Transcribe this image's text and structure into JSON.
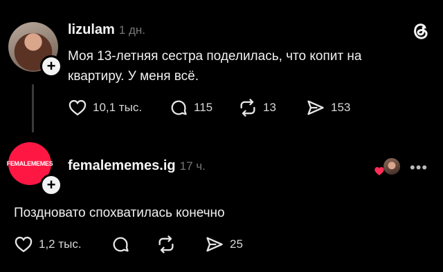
{
  "post1": {
    "username": "lizulam",
    "time": "1 дн.",
    "text_line1": "Моя 13-летняя сестра поделилась, что копит на",
    "text_line2": "квартиру. У меня всё.",
    "likes": "10,1 тыс.",
    "comments": "115",
    "reposts": "13",
    "shares": "153"
  },
  "post2": {
    "username": "femalememes.ig",
    "time": "17 ч.",
    "avatar_text": "FEMALEMEMES",
    "text": "Поздновато спохватилась конечно",
    "likes": "1,2 тыс.",
    "shares": "25"
  },
  "colors": {
    "brand_pink": "#ff1744",
    "like_red": "#ff2d55"
  }
}
